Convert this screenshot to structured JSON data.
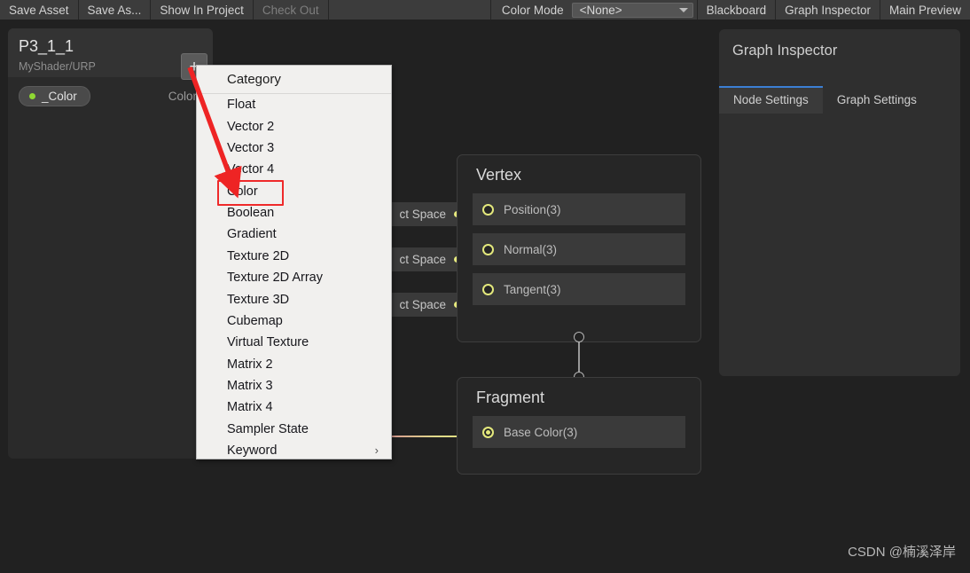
{
  "toolbar": {
    "buttons": [
      {
        "label": "Save Asset",
        "disabled": false
      },
      {
        "label": "Save As...",
        "disabled": false
      },
      {
        "label": "Show In Project",
        "disabled": false
      },
      {
        "label": "Check Out",
        "disabled": true
      }
    ],
    "color_mode_label": "Color Mode",
    "color_mode_value": "<None>",
    "right_buttons": [
      {
        "label": "Blackboard"
      },
      {
        "label": "Graph Inspector"
      },
      {
        "label": "Main Preview"
      }
    ]
  },
  "blackboard": {
    "title": "P3_1_1",
    "subtitle": "MyShader/URP",
    "add_button_label": "+",
    "properties": [
      {
        "name": "_Color",
        "type": "Color",
        "dot_color": "#8fd832"
      }
    ]
  },
  "context_menu": {
    "header": "Category",
    "items": [
      {
        "label": "Float",
        "highlighted": false,
        "submenu": false
      },
      {
        "label": "Vector 2",
        "highlighted": false,
        "submenu": false
      },
      {
        "label": "Vector 3",
        "highlighted": false,
        "submenu": false
      },
      {
        "label": "Vector 4",
        "highlighted": false,
        "submenu": false
      },
      {
        "label": "Color",
        "highlighted": true,
        "submenu": false
      },
      {
        "label": "Boolean",
        "highlighted": false,
        "submenu": false
      },
      {
        "label": "Gradient",
        "highlighted": false,
        "submenu": false
      },
      {
        "label": "Texture 2D",
        "highlighted": false,
        "submenu": false
      },
      {
        "label": "Texture 2D Array",
        "highlighted": false,
        "submenu": false
      },
      {
        "label": "Texture 3D",
        "highlighted": false,
        "submenu": false
      },
      {
        "label": "Cubemap",
        "highlighted": false,
        "submenu": false
      },
      {
        "label": "Virtual Texture",
        "highlighted": false,
        "submenu": false
      },
      {
        "label": "Matrix 2",
        "highlighted": false,
        "submenu": false
      },
      {
        "label": "Matrix 3",
        "highlighted": false,
        "submenu": false
      },
      {
        "label": "Matrix 4",
        "highlighted": false,
        "submenu": false
      },
      {
        "label": "Sampler State",
        "highlighted": false,
        "submenu": false
      },
      {
        "label": "Keyword",
        "highlighted": false,
        "submenu": true,
        "chevron": "›"
      }
    ]
  },
  "graph": {
    "object_space_nodes": [
      {
        "label": "ct Space"
      },
      {
        "label": "ct Space"
      },
      {
        "label": "ct Space"
      }
    ],
    "vertex_node": {
      "title": "Vertex",
      "ports": [
        {
          "label": "Position(3)",
          "connected": false
        },
        {
          "label": "Normal(3)",
          "connected": false
        },
        {
          "label": "Tangent(3)",
          "connected": false
        }
      ]
    },
    "fragment_node": {
      "title": "Fragment",
      "ports": [
        {
          "label": "Base Color(3)",
          "connected": true
        }
      ]
    }
  },
  "inspector": {
    "title": "Graph Inspector",
    "tabs": [
      {
        "label": "Node Settings",
        "active": true
      },
      {
        "label": "Graph Settings",
        "active": false
      }
    ]
  },
  "annotation": {
    "arrow_color": "#ee2424",
    "highlight_color": "#ef2a2a"
  },
  "watermark": {
    "text": "CSDN @楠溪泽岸"
  }
}
